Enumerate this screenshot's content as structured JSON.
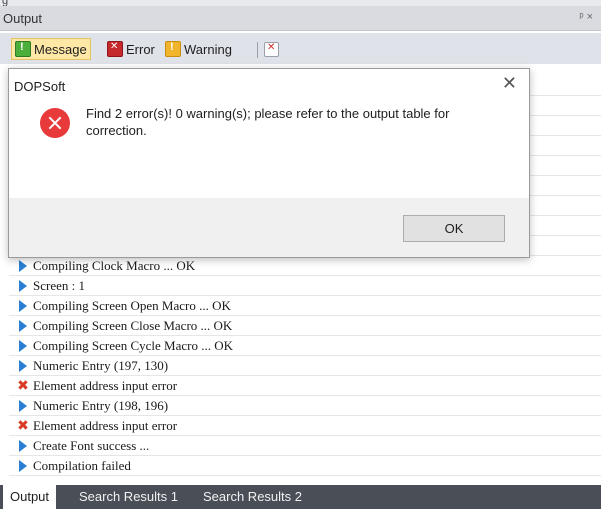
{
  "panel": {
    "title": "Output",
    "pin_glyph": "ᵖ ×",
    "top_fragment": "g"
  },
  "toolbar": {
    "message_label": "Message",
    "error_label": "Error",
    "warning_label": "Warning"
  },
  "output_rows": [
    {
      "type": "info",
      "text": "Compiling Clock Macro ... OK"
    },
    {
      "type": "info",
      "text": "Screen : 1"
    },
    {
      "type": "info",
      "text": "Compiling Screen Open Macro ... OK"
    },
    {
      "type": "info",
      "text": "Compiling Screen Close Macro ... OK"
    },
    {
      "type": "info",
      "text": "Compiling Screen Cycle Macro ... OK"
    },
    {
      "type": "info",
      "text": "Numeric Entry (197, 130)"
    },
    {
      "type": "error",
      "text": "Element address input error"
    },
    {
      "type": "info",
      "text": "Numeric Entry (198, 196)"
    },
    {
      "type": "error",
      "text": "Element address input error"
    },
    {
      "type": "info",
      "text": "Create Font success ..."
    },
    {
      "type": "info",
      "text": "Compilation failed"
    }
  ],
  "tabs": [
    "Output",
    "Search Results 1",
    "Search Results 2"
  ],
  "dialog": {
    "title": "DOPSoft",
    "message": "Find 2 error(s)! 0 warning(s); please refer to the output table for correction.",
    "ok_label": "OK"
  },
  "icons": {
    "message": "message-icon",
    "error": "error-icon",
    "warning": "warning-icon",
    "clear": "clear-output-icon",
    "info_row": "info-arrow-icon",
    "error_row": "red-x-icon",
    "dialog_error": "error-circle-icon"
  },
  "colors": {
    "active_filter": "#ffe8a6",
    "tab_bar": "#4a4f57",
    "info_arrow": "#2a7fd4",
    "error_mark": "#d83a23"
  }
}
